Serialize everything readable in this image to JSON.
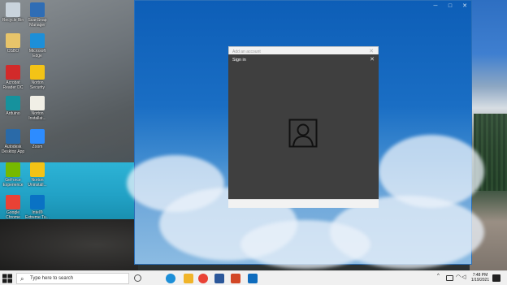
{
  "desktop": {
    "icons": [
      {
        "label": "Recycle Bin",
        "color": "#c9d3dc"
      },
      {
        "label": "ScanSnap Manager",
        "color": "#2f6db5"
      },
      {
        "label": "OSBO",
        "color": "#e7c46a"
      },
      {
        "label": "Microsoft Edge",
        "color": "#1d8fd8"
      },
      {
        "label": "Acrobat Reader DC",
        "color": "#d22a2a"
      },
      {
        "label": "Norton Security",
        "color": "#f3c316"
      },
      {
        "label": "Arduino",
        "color": "#16929d"
      },
      {
        "label": "Norton Installat...",
        "color": "#f1efe6"
      },
      {
        "label": "Autodesk Desktop App",
        "color": "#2a6aa8"
      },
      {
        "label": "Zoom",
        "color": "#2d8cff"
      },
      {
        "label": "GeForce Experience",
        "color": "#76b900"
      },
      {
        "label": "Norton Uninstall...",
        "color": "#f3c316"
      },
      {
        "label": "Google Chrome",
        "color": "#e94235"
      },
      {
        "label": "Intel® Extreme Tu...",
        "color": "#0a72c4"
      }
    ]
  },
  "dialog_outer": {
    "title": "Add an account",
    "close_glyph": "✕"
  },
  "dialog_inner": {
    "title": "Sign in",
    "close_glyph": "✕"
  },
  "taskbar": {
    "search_placeholder": "Type here to search",
    "pinned": [
      {
        "name": "task-view",
        "color": "#555555"
      },
      {
        "name": "edge",
        "color": "#1d8fd8"
      },
      {
        "name": "file-explorer",
        "color": "#f0b429"
      },
      {
        "name": "chrome",
        "color": "#e94235"
      },
      {
        "name": "word",
        "color": "#2b579a"
      },
      {
        "name": "powerpoint",
        "color": "#d24726"
      },
      {
        "name": "mail",
        "color": "#0f6cbd"
      }
    ],
    "tray_chevron": "^",
    "clock_time": "7:48 PM",
    "clock_date": "1/19/2021"
  }
}
